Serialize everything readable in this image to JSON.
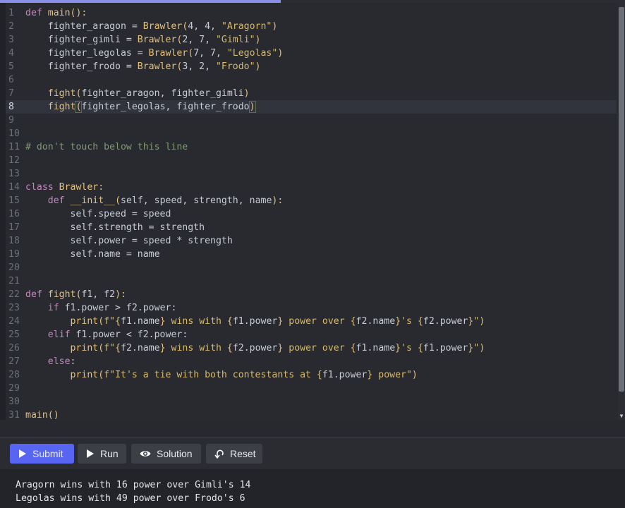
{
  "editor": {
    "active_line": 8,
    "lines": [
      {
        "num": "1",
        "tokens": [
          {
            "t": "def ",
            "c": "kw"
          },
          {
            "t": "main",
            "c": "fn"
          },
          {
            "t": "():",
            "c": "pn"
          }
        ]
      },
      {
        "num": "2",
        "tokens": [
          {
            "t": "    fighter_aragon = ",
            "c": ""
          },
          {
            "t": "Brawler",
            "c": "fn"
          },
          {
            "t": "(",
            "c": "pn"
          },
          {
            "t": "4, 4, ",
            "c": ""
          },
          {
            "t": "\"Aragorn\"",
            "c": "str"
          },
          {
            "t": ")",
            "c": "pn"
          }
        ]
      },
      {
        "num": "3",
        "tokens": [
          {
            "t": "    fighter_gimli = ",
            "c": ""
          },
          {
            "t": "Brawler",
            "c": "fn"
          },
          {
            "t": "(",
            "c": "pn"
          },
          {
            "t": "2, 7, ",
            "c": ""
          },
          {
            "t": "\"Gimli\"",
            "c": "str"
          },
          {
            "t": ")",
            "c": "pn"
          }
        ]
      },
      {
        "num": "4",
        "tokens": [
          {
            "t": "    fighter_legolas = ",
            "c": ""
          },
          {
            "t": "Brawler",
            "c": "fn"
          },
          {
            "t": "(",
            "c": "pn"
          },
          {
            "t": "7, 7, ",
            "c": ""
          },
          {
            "t": "\"Legolas\"",
            "c": "str"
          },
          {
            "t": ")",
            "c": "pn"
          }
        ]
      },
      {
        "num": "5",
        "tokens": [
          {
            "t": "    fighter_frodo = ",
            "c": ""
          },
          {
            "t": "Brawler",
            "c": "fn"
          },
          {
            "t": "(",
            "c": "pn"
          },
          {
            "t": "3, 2, ",
            "c": ""
          },
          {
            "t": "\"Frodo\"",
            "c": "str"
          },
          {
            "t": ")",
            "c": "pn"
          }
        ]
      },
      {
        "num": "6",
        "tokens": []
      },
      {
        "num": "7",
        "tokens": [
          {
            "t": "    ",
            "c": ""
          },
          {
            "t": "fight",
            "c": "fn"
          },
          {
            "t": "(",
            "c": "pn"
          },
          {
            "t": "fighter_aragon, fighter_gimli",
            "c": ""
          },
          {
            "t": ")",
            "c": "pn"
          }
        ]
      },
      {
        "num": "8",
        "tokens": [
          {
            "t": "    ",
            "c": ""
          },
          {
            "t": "fight",
            "c": "fn"
          },
          {
            "t": "(",
            "c": "pn bracket-hl"
          },
          {
            "t": "fighter_legolas, fighter_frodo",
            "c": ""
          },
          {
            "t": ")",
            "c": "pn bracket-hl"
          }
        ]
      },
      {
        "num": "9",
        "tokens": []
      },
      {
        "num": "10",
        "tokens": []
      },
      {
        "num": "11",
        "tokens": [
          {
            "t": "# don't touch below this line",
            "c": "com"
          }
        ]
      },
      {
        "num": "12",
        "tokens": []
      },
      {
        "num": "13",
        "tokens": []
      },
      {
        "num": "14",
        "tokens": [
          {
            "t": "class ",
            "c": "kw"
          },
          {
            "t": "Brawler",
            "c": "cls"
          },
          {
            "t": ":",
            "c": "pn"
          }
        ]
      },
      {
        "num": "15",
        "tokens": [
          {
            "t": "    ",
            "c": ""
          },
          {
            "t": "def ",
            "c": "kw"
          },
          {
            "t": "__init__",
            "c": "fn"
          },
          {
            "t": "(",
            "c": "pn"
          },
          {
            "t": "self, speed, strength, name",
            "c": ""
          },
          {
            "t": "):",
            "c": "pn"
          }
        ]
      },
      {
        "num": "16",
        "tokens": [
          {
            "t": "        self.speed = speed",
            "c": ""
          }
        ]
      },
      {
        "num": "17",
        "tokens": [
          {
            "t": "        self.strength = strength",
            "c": ""
          }
        ]
      },
      {
        "num": "18",
        "tokens": [
          {
            "t": "        self.power = speed * strength",
            "c": ""
          }
        ]
      },
      {
        "num": "19",
        "tokens": [
          {
            "t": "        self.name = name",
            "c": ""
          }
        ]
      },
      {
        "num": "20",
        "tokens": []
      },
      {
        "num": "21",
        "tokens": []
      },
      {
        "num": "22",
        "tokens": [
          {
            "t": "def ",
            "c": "kw"
          },
          {
            "t": "fight",
            "c": "fn"
          },
          {
            "t": "(",
            "c": "pn"
          },
          {
            "t": "f1, f2",
            "c": ""
          },
          {
            "t": "):",
            "c": "pn"
          }
        ]
      },
      {
        "num": "23",
        "tokens": [
          {
            "t": "    ",
            "c": ""
          },
          {
            "t": "if ",
            "c": "kw"
          },
          {
            "t": "f1.power > f2.power:",
            "c": ""
          }
        ]
      },
      {
        "num": "24",
        "tokens": [
          {
            "t": "        ",
            "c": ""
          },
          {
            "t": "print",
            "c": "fn"
          },
          {
            "t": "(",
            "c": "pn"
          },
          {
            "t": "f\"",
            "c": "str"
          },
          {
            "t": "{",
            "c": "pn"
          },
          {
            "t": "f1.name",
            "c": ""
          },
          {
            "t": "}",
            "c": "pn"
          },
          {
            "t": " wins with ",
            "c": "str"
          },
          {
            "t": "{",
            "c": "pn"
          },
          {
            "t": "f1.power",
            "c": ""
          },
          {
            "t": "}",
            "c": "pn"
          },
          {
            "t": " power over ",
            "c": "str"
          },
          {
            "t": "{",
            "c": "pn"
          },
          {
            "t": "f2.name",
            "c": ""
          },
          {
            "t": "}",
            "c": "pn"
          },
          {
            "t": "'s ",
            "c": "str"
          },
          {
            "t": "{",
            "c": "pn"
          },
          {
            "t": "f2.power",
            "c": ""
          },
          {
            "t": "}",
            "c": "pn"
          },
          {
            "t": "\"",
            "c": "str"
          },
          {
            "t": ")",
            "c": "pn"
          }
        ]
      },
      {
        "num": "25",
        "tokens": [
          {
            "t": "    ",
            "c": ""
          },
          {
            "t": "elif ",
            "c": "kw"
          },
          {
            "t": "f1.power < f2.power:",
            "c": ""
          }
        ]
      },
      {
        "num": "26",
        "tokens": [
          {
            "t": "        ",
            "c": ""
          },
          {
            "t": "print",
            "c": "fn"
          },
          {
            "t": "(",
            "c": "pn"
          },
          {
            "t": "f\"",
            "c": "str"
          },
          {
            "t": "{",
            "c": "pn"
          },
          {
            "t": "f2.name",
            "c": ""
          },
          {
            "t": "}",
            "c": "pn"
          },
          {
            "t": " wins with ",
            "c": "str"
          },
          {
            "t": "{",
            "c": "pn"
          },
          {
            "t": "f2.power",
            "c": ""
          },
          {
            "t": "}",
            "c": "pn"
          },
          {
            "t": " power over ",
            "c": "str"
          },
          {
            "t": "{",
            "c": "pn"
          },
          {
            "t": "f1.name",
            "c": ""
          },
          {
            "t": "}",
            "c": "pn"
          },
          {
            "t": "'s ",
            "c": "str"
          },
          {
            "t": "{",
            "c": "pn"
          },
          {
            "t": "f1.power",
            "c": ""
          },
          {
            "t": "}",
            "c": "pn"
          },
          {
            "t": "\"",
            "c": "str"
          },
          {
            "t": ")",
            "c": "pn"
          }
        ]
      },
      {
        "num": "27",
        "tokens": [
          {
            "t": "    ",
            "c": ""
          },
          {
            "t": "else",
            "c": "kw"
          },
          {
            "t": ":",
            "c": ""
          }
        ]
      },
      {
        "num": "28",
        "tokens": [
          {
            "t": "        ",
            "c": ""
          },
          {
            "t": "print",
            "c": "fn"
          },
          {
            "t": "(",
            "c": "pn"
          },
          {
            "t": "f\"It's a tie with both contestants at ",
            "c": "str"
          },
          {
            "t": "{",
            "c": "pn"
          },
          {
            "t": "f1.power",
            "c": ""
          },
          {
            "t": "}",
            "c": "pn"
          },
          {
            "t": " power\"",
            "c": "str"
          },
          {
            "t": ")",
            "c": "pn"
          }
        ]
      },
      {
        "num": "29",
        "tokens": []
      },
      {
        "num": "30",
        "tokens": []
      },
      {
        "num": "31",
        "tokens": [
          {
            "t": "main",
            "c": "fn"
          },
          {
            "t": "()",
            "c": "pn"
          }
        ]
      }
    ]
  },
  "toolbar": {
    "submit_label": "Submit",
    "run_label": "Run",
    "solution_label": "Solution",
    "reset_label": "Reset"
  },
  "output": {
    "lines": [
      "Aragorn wins with 16 power over Gimli's 14",
      "Legolas wins with 49 power over Frodo's 6"
    ]
  },
  "colors": {
    "submit_accent": "#5865f2",
    "progress_accent": "#8a8fe8"
  },
  "icons": {
    "submit": "play-icon",
    "run": "play-icon",
    "solution": "eye-icon",
    "reset": "undo-icon"
  }
}
